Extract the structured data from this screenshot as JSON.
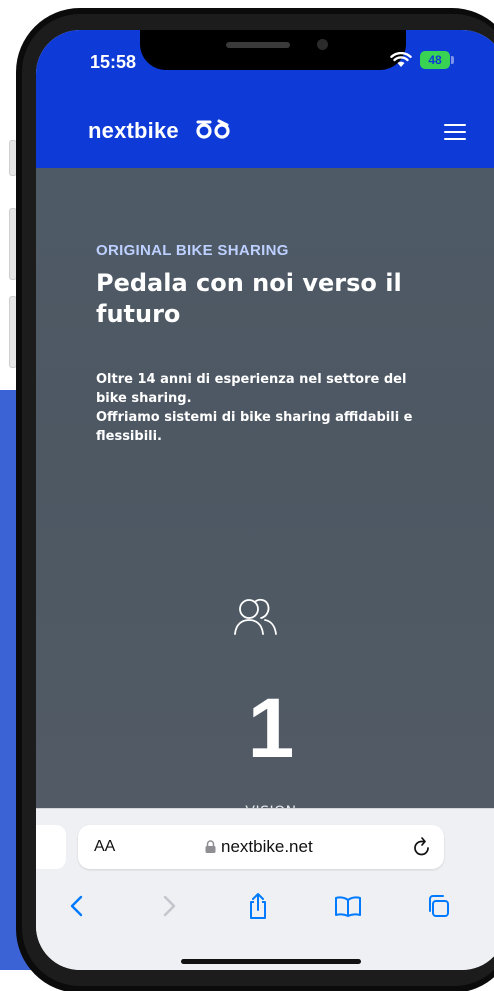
{
  "status_bar": {
    "time": "15:58",
    "battery": "48",
    "icons": [
      "wifi-icon",
      "battery-icon"
    ]
  },
  "nav": {
    "logo_text": "nextbike",
    "logo_icon": "bike-logo-icon",
    "menu_icon": "hamburger-menu-icon"
  },
  "hero": {
    "eyebrow": "ORIGINAL BIKE SHARING",
    "headline": "Pedala con noi verso il futuro",
    "body_line1": "Oltre 14 anni di esperienza nel settore del bike sharing.",
    "body_line2": "Offriamo sistemi di bike sharing affidabili e flessibili."
  },
  "stat": {
    "icon": "people-icon",
    "number": "1",
    "label": "VISION"
  },
  "browser": {
    "text_size_label": "AA",
    "url": "nextbike.net",
    "toolbar_icons": [
      "back-icon",
      "forward-icon",
      "share-icon",
      "bookmarks-icon",
      "tabs-icon"
    ]
  },
  "colors": {
    "brand_blue": "#0e3bd8",
    "accent_blue": "#007aff",
    "hero_bg": "#4e5a66",
    "eyebrow": "#bdd0ff"
  }
}
